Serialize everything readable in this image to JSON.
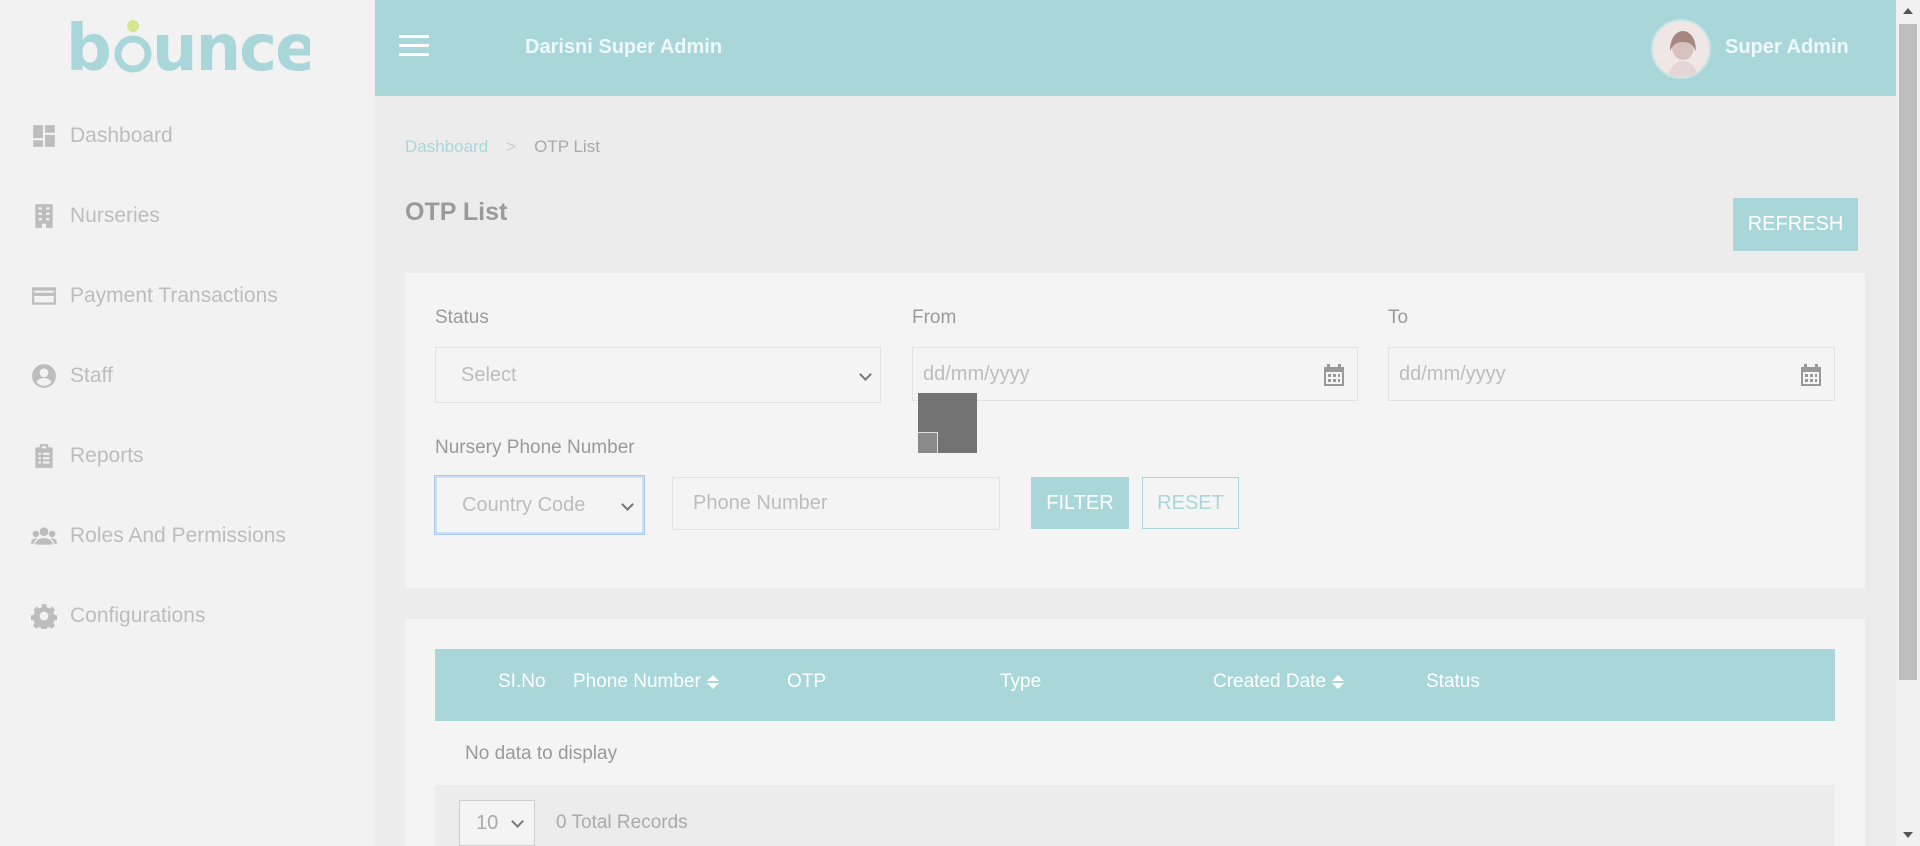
{
  "app": {
    "logo_text": "bounce",
    "header_title": "Darisni Super Admin",
    "user_name": "Super Admin"
  },
  "sidebar": {
    "items": [
      {
        "label": "Dashboard",
        "icon": "dashboard-icon"
      },
      {
        "label": "Nurseries",
        "icon": "building-icon"
      },
      {
        "label": "Payment Transactions",
        "icon": "credit-card-icon"
      },
      {
        "label": "Staff",
        "icon": "user-circle-icon"
      },
      {
        "label": "Reports",
        "icon": "clipboard-icon"
      },
      {
        "label": "Roles And Permissions",
        "icon": "users-icon"
      },
      {
        "label": "Configurations",
        "icon": "gear-icon"
      }
    ]
  },
  "breadcrumb": {
    "home": "Dashboard",
    "separator": ">",
    "current": "OTP List"
  },
  "page": {
    "title": "OTP List",
    "refresh_label": "REFRESH"
  },
  "filters": {
    "status_label": "Status",
    "status_value": "Select",
    "from_label": "From",
    "from_placeholder": "dd/mm/yyyy",
    "to_label": "To",
    "to_placeholder": "dd/mm/yyyy",
    "phone_label": "Nursery Phone Number",
    "country_code_value": "Country Code",
    "phone_placeholder": "Phone Number",
    "filter_label": "FILTER",
    "reset_label": "RESET"
  },
  "table": {
    "columns": [
      "SI.No",
      "Phone Number",
      "OTP",
      "Type",
      "Created Date",
      "Status"
    ],
    "empty_message": "No data to display",
    "page_size": "10",
    "total_records": "0 Total Records"
  },
  "colors": {
    "accent": "#a9d7d9",
    "sidebar_bg": "#f2f2f2",
    "content_bg": "#ececec",
    "card_bg": "#f4f4f4"
  }
}
